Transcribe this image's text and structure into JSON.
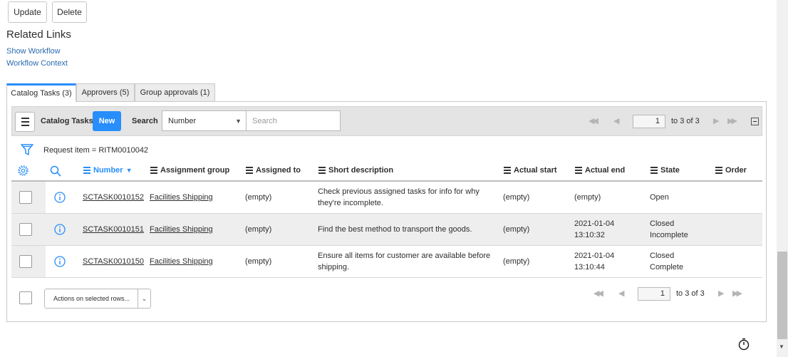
{
  "buttons": {
    "update": "Update",
    "delete": "Delete"
  },
  "related_links": {
    "title": "Related Links",
    "show_workflow": "Show Workflow",
    "workflow_context": "Workflow Context"
  },
  "tabs": [
    {
      "label": "Catalog Tasks (3)",
      "active": true
    },
    {
      "label": "Approvers (5)",
      "active": false
    },
    {
      "label": "Group approvals (1)",
      "active": false
    }
  ],
  "toolbar": {
    "title": "Catalog Tasks",
    "new_label": "New",
    "search_label": "Search",
    "search_field": "Number",
    "search_placeholder": "Search",
    "page_value": "1",
    "page_total": "to 3 of 3"
  },
  "filter": {
    "text": "Request item = RITM0010042"
  },
  "columns": [
    "Number",
    "Assignment group",
    "Assigned to",
    "Short description",
    "Actual start",
    "Actual end",
    "State",
    "Order"
  ],
  "rows": [
    {
      "number": "SCTASK0010152",
      "group": "Facilities Shipping",
      "assigned": "(empty)",
      "desc1": "Check previous assigned tasks for info for why",
      "desc2": "they're incomplete.",
      "start": "(empty)",
      "end1": "(empty)",
      "end2": "",
      "state1": "Open",
      "state2": ""
    },
    {
      "number": "SCTASK0010151",
      "group": "Facilities Shipping",
      "assigned": "(empty)",
      "desc1": "Find the best method to transport the goods.",
      "desc2": "",
      "start": "(empty)",
      "end1": "2021-01-04",
      "end2": "13:10:32",
      "state1": "Closed",
      "state2": "Incomplete"
    },
    {
      "number": "SCTASK0010150",
      "group": "Facilities Shipping",
      "assigned": "(empty)",
      "desc1": "Ensure all items for customer are available before",
      "desc2": "shipping.",
      "start": "(empty)",
      "end1": "2021-01-04",
      "end2": "13:10:44",
      "state1": "Closed",
      "state2": "Complete"
    }
  ],
  "footer": {
    "actions_label": "Actions on selected rows...",
    "page_value": "1",
    "page_total": "to 3 of 3"
  },
  "colors": {
    "accent": "#278efc",
    "link": "#2b6cb0"
  }
}
